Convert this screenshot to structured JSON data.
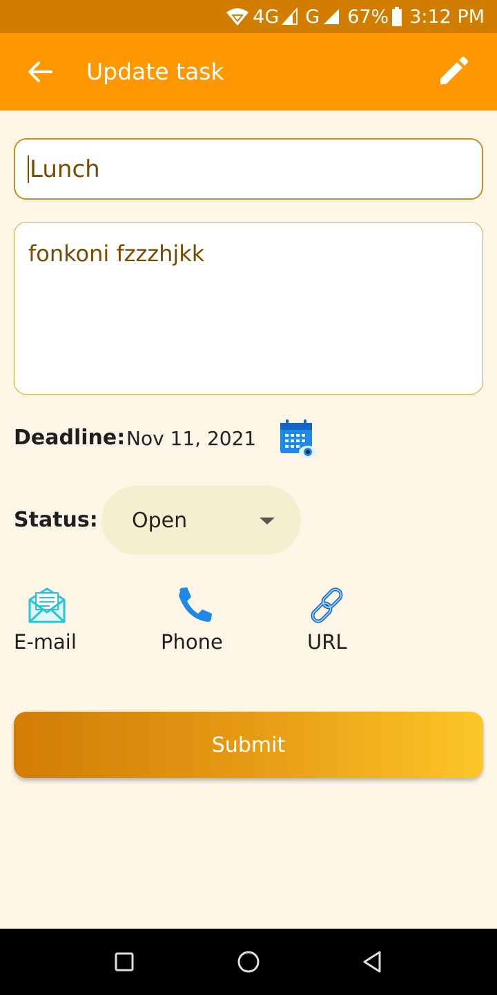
{
  "status_bar": {
    "network": "4G",
    "network2": "G",
    "battery": "67%",
    "time": "3:12 PM"
  },
  "app_bar": {
    "title": "Update task",
    "back_icon": "arrow-left-icon",
    "edit_icon": "pencil-icon"
  },
  "form": {
    "title_value": "Lunch",
    "description_value": "fonkoni fzzzhjkk",
    "deadline_label": "Deadline:",
    "deadline_value": "Nov 11, 2021",
    "status_label": "Status:",
    "status_value": "Open"
  },
  "contacts": [
    {
      "label": "E-mail",
      "icon": "envelope-icon"
    },
    {
      "label": "Phone",
      "icon": "phone-icon"
    },
    {
      "label": "URL",
      "icon": "link-icon"
    }
  ],
  "submit_label": "Submit",
  "colors": {
    "status_bar": "#d17e00",
    "app_bar": "#ff9800",
    "background": "#fdf5e6",
    "accent_text": "#7a4a00"
  }
}
